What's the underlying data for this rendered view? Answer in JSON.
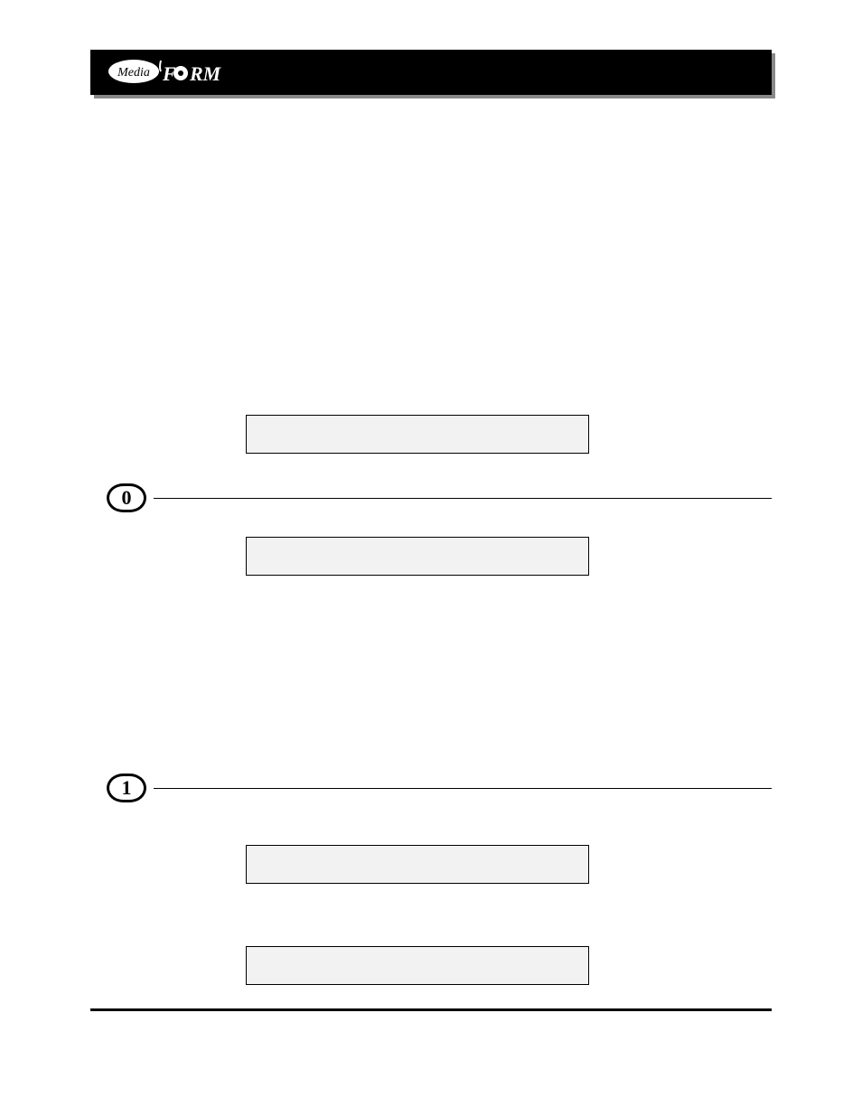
{
  "header": {
    "logo_media": "Media",
    "logo_form": "FORM"
  },
  "steps": {
    "step0": {
      "number": "0"
    },
    "step1": {
      "number": "1"
    }
  },
  "boxes": {
    "box1": "",
    "box2": "",
    "box3": "",
    "box4": ""
  }
}
